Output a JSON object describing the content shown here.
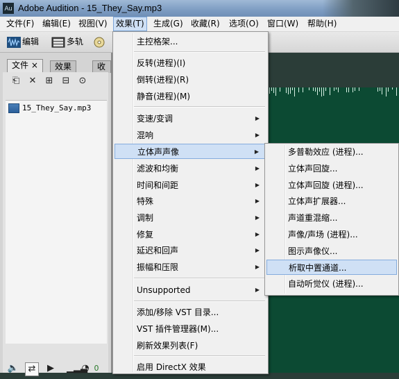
{
  "window": {
    "title": "Adobe Audition - 15_They_Say.mp3",
    "app_icon_text": "Au"
  },
  "menubar": {
    "items": [
      {
        "label": "文件(F)"
      },
      {
        "label": "编辑(E)"
      },
      {
        "label": "视图(V)"
      },
      {
        "label": "效果(T)"
      },
      {
        "label": "生成(G)"
      },
      {
        "label": "收藏(R)"
      },
      {
        "label": "选项(O)"
      },
      {
        "label": "窗口(W)"
      },
      {
        "label": "帮助(H)"
      }
    ]
  },
  "toolbar": {
    "edit_label": "编辑",
    "multitrack_label": "多轨"
  },
  "panel": {
    "tabs": [
      {
        "label": "文件"
      },
      {
        "label": "效果"
      },
      {
        "label": "收藏"
      }
    ],
    "files": [
      {
        "name": "15_They_Say.mp3"
      }
    ],
    "volume_readout": "0"
  },
  "effects_menu": {
    "items": [
      {
        "label": "主控格架...",
        "submenu": false
      },
      {
        "label": "反转(进程)(I)",
        "submenu": false
      },
      {
        "label": "倒转(进程)(R)",
        "submenu": false
      },
      {
        "label": "静音(进程)(M)",
        "submenu": false
      },
      {
        "label": "变速/变调",
        "submenu": true
      },
      {
        "label": "混响",
        "submenu": true
      },
      {
        "label": "立体声声像",
        "submenu": true,
        "highlighted": true
      },
      {
        "label": "滤波和均衡",
        "submenu": true
      },
      {
        "label": "时间和间距",
        "submenu": true
      },
      {
        "label": "特殊",
        "submenu": true
      },
      {
        "label": "调制",
        "submenu": true
      },
      {
        "label": "修复",
        "submenu": true
      },
      {
        "label": "延迟和回声",
        "submenu": true
      },
      {
        "label": "振幅和压限",
        "submenu": true
      },
      {
        "label": "Unsupported",
        "submenu": true
      },
      {
        "label": "添加/移除 VST 目录...",
        "submenu": false
      },
      {
        "label": "VST 插件管理器(M)...",
        "submenu": false
      },
      {
        "label": "刷新效果列表(F)",
        "submenu": false
      },
      {
        "label": "启用 DirectX 效果",
        "submenu": false
      }
    ]
  },
  "stereo_submenu": {
    "items": [
      {
        "label": "多普勒效应 (进程)..."
      },
      {
        "label": "立体声回旋..."
      },
      {
        "label": "立体声回旋 (进程)..."
      },
      {
        "label": "立体声扩展器..."
      },
      {
        "label": "声道重混缩..."
      },
      {
        "label": "声像/声场 (进程)..."
      },
      {
        "label": "图示声像仪..."
      },
      {
        "label": "析取中置通道...",
        "highlighted": true
      },
      {
        "label": "自动听觉仪 (进程)..."
      }
    ]
  },
  "colors": {
    "highlight": "#cfe0f5",
    "waveform_bg": "#0c4a33",
    "menu_bg": "#f0f0f0"
  }
}
